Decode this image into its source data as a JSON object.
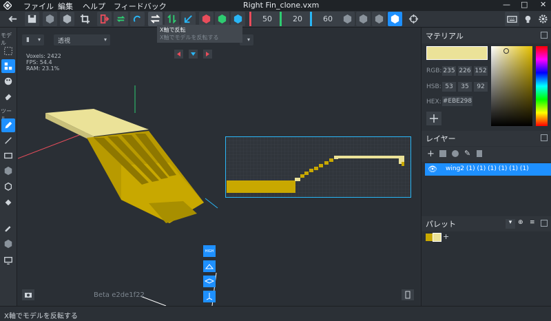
{
  "window": {
    "title": "Right Fin_clone.vxm"
  },
  "menu": {
    "items": [
      "ファイル",
      "編集",
      "ヘルプ",
      "フィードバック"
    ]
  },
  "toolbar": {
    "num_red": "50",
    "num_green": "20",
    "num_blue": "60",
    "colors": {
      "red": "#e84d5b",
      "green": "#2ecc71",
      "blue": "#29b6f6",
      "accent": "#1e90ff"
    }
  },
  "tooltip": {
    "title": "X軸で反転",
    "subtitle": "X軸でモデルを反転する"
  },
  "left_tools": {
    "section_model": "モデル",
    "section_tool": "ツール"
  },
  "viewport": {
    "view_mode": "透視",
    "stats": {
      "voxels": "Voxels: 2422",
      "fps": "FPS: 54.4",
      "ram": "RAM: 23.1%"
    },
    "version": "Beta e2de1f22",
    "quality_label": "HIGH"
  },
  "material": {
    "header": "マテリアル",
    "rgb_label": "RGB:",
    "rgb": [
      "235",
      "226",
      "152"
    ],
    "hsb_label": "HSB:",
    "hsb": [
      "53",
      "35",
      "92"
    ],
    "hex_label": "HEX:",
    "hex": "#EBE298",
    "swatch_color": "#ebe298"
  },
  "layers": {
    "header": "レイヤー",
    "items": [
      {
        "name": "wing2 (1) (1) (1) (1) (1) (1)"
      }
    ]
  },
  "palette": {
    "header": "パレット",
    "colors": [
      "#c8a800",
      "#ebe298"
    ]
  },
  "status": {
    "text": "X軸でモデルを反転する"
  }
}
